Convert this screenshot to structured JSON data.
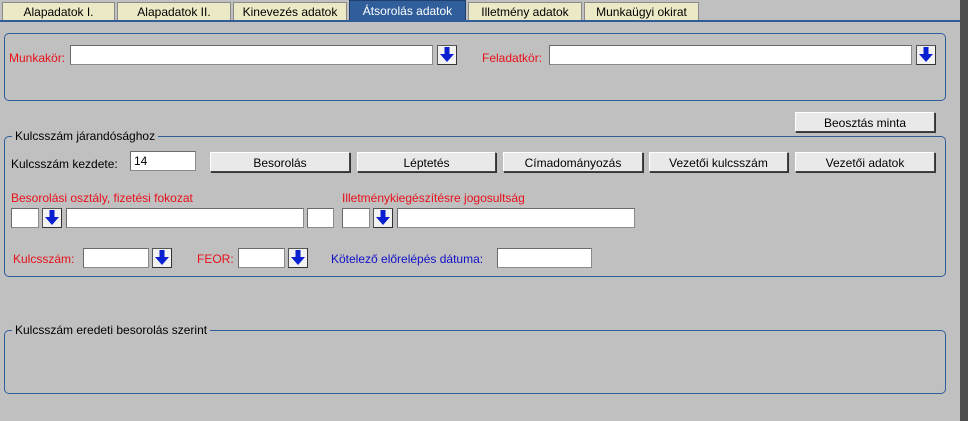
{
  "tabs": [
    {
      "label": "Alapadatok I."
    },
    {
      "label": "Alapadatok II."
    },
    {
      "label": "Kinevezés adatok"
    },
    {
      "label": "Átsorolás adatok"
    },
    {
      "label": "Illetmény adatok"
    },
    {
      "label": "Munkaügyi okirat"
    }
  ],
  "top_section": {
    "munkakor_label": "Munkakör:",
    "munkakor_value": "",
    "feladatkor_label": "Feladatkör:",
    "feladatkor_value": ""
  },
  "beosztas_minta_label": "Beosztás minta",
  "kulcsszam_group": {
    "legend": "Kulcsszám járandósághoz",
    "kezdete_label": "Kulcsszám kezdete:",
    "kezdete_value": "14",
    "buttons": [
      "Besorolás",
      "Léptetés",
      "Címadományozás",
      "Vezetői kulcsszám",
      "Vezetői adatok"
    ],
    "besorolasi_label": "Besorolási osztály, fizetési fokozat",
    "illetmeny_label": "Illetménykiegészítésre jogosultság",
    "kulcsszam_label": "Kulcsszám:",
    "feor_label": "FEOR:",
    "kotelezo_label": "Kötelező előrelépés dátuma:"
  },
  "eredeti_group": {
    "legend": "Kulcsszám eredeti besorolás szerint"
  },
  "colors": {
    "accent": "#2f5e9b",
    "tab_bg": "#ece9c6",
    "required_label": "#e8101a",
    "info_label": "#1010c8",
    "panel_bg": "#c0c0c0"
  }
}
